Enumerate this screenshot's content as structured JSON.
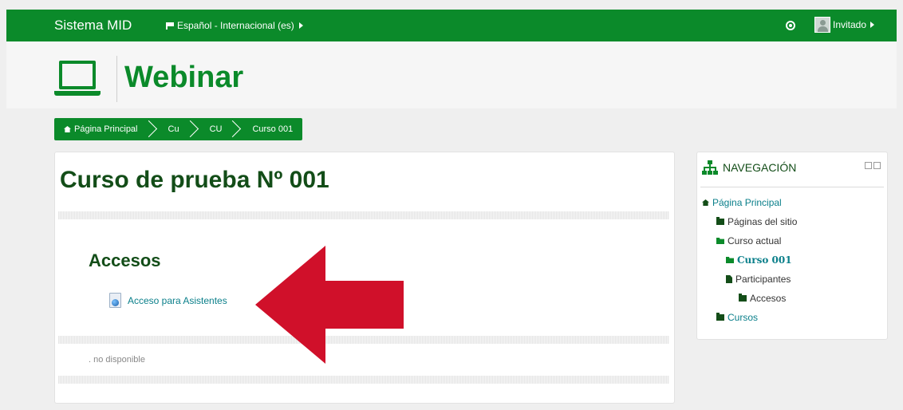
{
  "navbar": {
    "brand": "Sistema MID",
    "language": "Español - Internacional (es)",
    "user": "Invitado"
  },
  "header": {
    "site_title": "Webinar"
  },
  "breadcrumb": [
    "Página Principal",
    "Cu",
    "CU",
    "Curso 001"
  ],
  "main": {
    "course_title": "Curso de prueba Nº 001",
    "section_title": "Accesos",
    "resource_link": "Acceso para Asistentes",
    "unavailable_text": ". no disponible"
  },
  "navigation": {
    "title": "NAVEGACIÓN",
    "items": [
      {
        "label": "Página Principal",
        "icon": "home-icon"
      },
      {
        "label": "Páginas del sitio",
        "icon": "folder-icon"
      },
      {
        "label": "Curso actual",
        "icon": "folder-open-icon"
      },
      {
        "label": "Curso 001",
        "icon": "folder-open-icon"
      },
      {
        "label": "Participantes",
        "icon": "file-icon"
      },
      {
        "label": "Accesos",
        "icon": "folder-icon"
      },
      {
        "label": "Cursos",
        "icon": "folder-icon"
      }
    ]
  },
  "colors": {
    "brand_green": "#0b8a2a",
    "dark_green": "#134d18",
    "link_teal": "#0a7f8a",
    "arrow_red": "#d0102a"
  }
}
